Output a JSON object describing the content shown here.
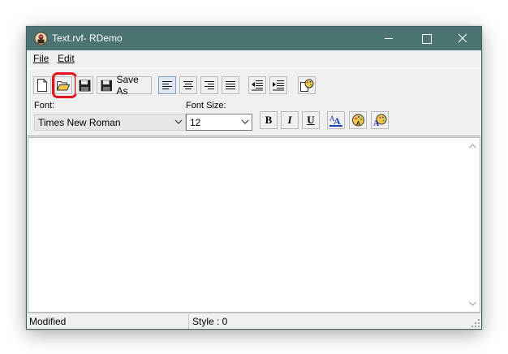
{
  "window": {
    "title": "Text.rvf- RDemo",
    "title_bar_color": "#4c7473",
    "icon": "rdemo-app-icon"
  },
  "window_controls": {
    "minimize_icon": "minimize-icon",
    "maximize_icon": "maximize-icon",
    "close_glyph": "✕"
  },
  "menu": {
    "file": "File",
    "edit": "Edit"
  },
  "toolbar": {
    "new_icon": "new-document-icon",
    "open_icon": "open-folder-icon",
    "save_icon": "floppy-disk-icon",
    "save_as_label": "Save As",
    "align_left_icon": "align-left-icon",
    "align_center_icon": "align-center-icon",
    "align_right_icon": "align-right-icon",
    "align_justify_icon": "align-justify-icon",
    "outdent_icon": "decrease-indent-icon",
    "indent_icon": "increase-indent-icon",
    "paragraph_color_icon": "paragraph-background-icon",
    "highlight_color": "#e0141e"
  },
  "format": {
    "font_label": "Font:",
    "font_value": "Times New Roman",
    "size_label": "Font Size:",
    "size_value": "12",
    "bold": "B",
    "italic": "I",
    "underline": "U",
    "text_color_icon": "font-color-icon",
    "text_bg_icon": "text-background-icon",
    "style_icon": "text-style-icon"
  },
  "status": {
    "left": "Modified",
    "right": "Style : 0"
  }
}
